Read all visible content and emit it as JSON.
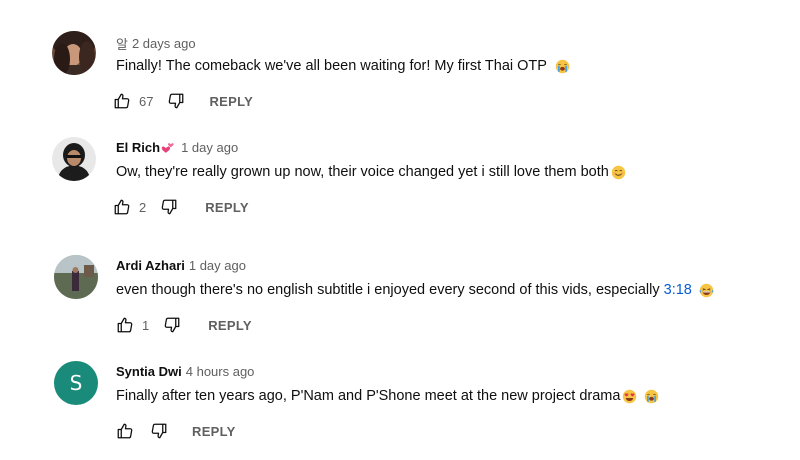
{
  "comments": [
    {
      "author_prefix": "알",
      "author": "",
      "time": "2 days ago",
      "text": "Finally! The comeback we've all been waiting for! My first Thai OTP",
      "timestamp_link": "",
      "emoji": [
        "loudly-crying-face"
      ],
      "likes": "67",
      "reply_label": "REPLY"
    },
    {
      "author_prefix": "",
      "author": "El Rich",
      "author_emoji": "two-hearts",
      "time": "1 day ago",
      "text": "Ow, they're really grown up now, their voice changed yet i still love them both",
      "timestamp_link": "",
      "emoji": [
        "smiling-face"
      ],
      "likes": "2",
      "reply_label": "REPLY"
    },
    {
      "author_prefix": "",
      "author": "Ardi Azhari",
      "time": "1 day ago",
      "text": "even though there's no english subtitle i enjoyed every second of this vids, especially",
      "timestamp_link": "3:18",
      "emoji": [
        "laughing-face"
      ],
      "likes": "1",
      "reply_label": "REPLY"
    },
    {
      "author_prefix": "",
      "author": "Syntia Dwi",
      "avatar_letter": "S",
      "avatar_color": "#1a8a7a",
      "time": "4 hours ago",
      "text": "Finally after ten years ago, P'Nam and P'Shone meet at the new project drama",
      "timestamp_link": "",
      "emoji": [
        "heart-eyes-face",
        "loudly-crying-face"
      ],
      "likes": "",
      "reply_label": "REPLY"
    }
  ],
  "colors": {
    "text_primary": "#0f0f0f",
    "text_secondary": "#606060",
    "link": "#065fd4"
  }
}
